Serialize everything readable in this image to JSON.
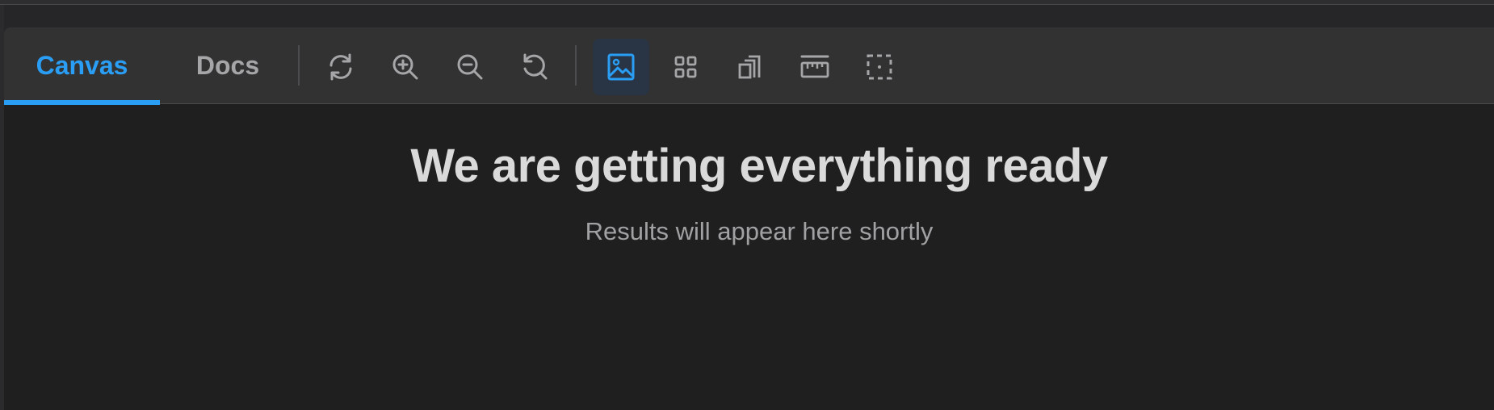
{
  "tabs": {
    "canvas_label": "Canvas",
    "docs_label": "Docs",
    "active": "Canvas"
  },
  "toolbar": {
    "tools": [
      {
        "icon": "refresh-icon",
        "active": false
      },
      {
        "icon": "zoom-in-icon",
        "active": false
      },
      {
        "icon": "zoom-out-icon",
        "active": false
      },
      {
        "icon": "reset-zoom-icon",
        "active": false
      },
      {
        "icon": "image-view-icon",
        "active": true
      },
      {
        "icon": "grid-view-icon",
        "active": false
      },
      {
        "icon": "layers-icon",
        "active": false
      },
      {
        "icon": "ruler-icon",
        "active": false
      },
      {
        "icon": "selection-icon",
        "active": false
      }
    ]
  },
  "main": {
    "heading": "We are getting everything ready",
    "subheading": "Results will appear here shortly"
  },
  "colors": {
    "accent": "#2a9df4",
    "background": "#1f1f1f",
    "toolbar": "#323233"
  }
}
